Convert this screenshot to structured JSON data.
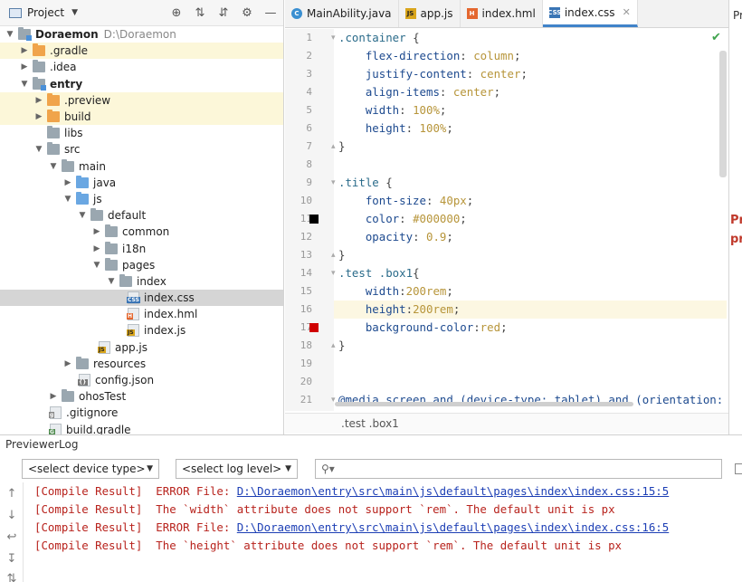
{
  "project_panel": {
    "title": "Project",
    "tree": [
      {
        "label": "Doraemon",
        "path": "D:\\Doraemon",
        "bold": true
      },
      {
        "label": ".gradle"
      },
      {
        "label": ".idea"
      },
      {
        "label": "entry",
        "bold": true
      },
      {
        "label": ".preview"
      },
      {
        "label": "build"
      },
      {
        "label": "libs"
      },
      {
        "label": "src"
      },
      {
        "label": "main"
      },
      {
        "label": "java"
      },
      {
        "label": "js"
      },
      {
        "label": "default"
      },
      {
        "label": "common"
      },
      {
        "label": "i18n"
      },
      {
        "label": "pages"
      },
      {
        "label": "index"
      },
      {
        "label": "index.css"
      },
      {
        "label": "index.hml"
      },
      {
        "label": "index.js"
      },
      {
        "label": "app.js"
      },
      {
        "label": "resources"
      },
      {
        "label": "config.json"
      },
      {
        "label": "ohosTest"
      },
      {
        "label": ".gitignore"
      },
      {
        "label": "build.gradle"
      }
    ]
  },
  "editor": {
    "tabs": [
      {
        "label": "MainAbility.java",
        "icon": "c-class-icon"
      },
      {
        "label": "app.js",
        "icon": "js-file-icon"
      },
      {
        "label": "index.hml",
        "icon": "hml-file-icon"
      },
      {
        "label": "index.css",
        "icon": "css-file-icon",
        "active": true
      }
    ],
    "cut_tab": "Pr",
    "line_numbers": [
      "1",
      "2",
      "3",
      "4",
      "5",
      "6",
      "7",
      "8",
      "9",
      "10",
      "11",
      "12",
      "13",
      "14",
      "15",
      "16",
      "17",
      "18",
      "19",
      "20",
      "21"
    ],
    "code": [
      ".container {",
      "    flex-direction: column;",
      "    justify-content: center;",
      "    align-items: center;",
      "    width: 100%;",
      "    height: 100%;",
      "}",
      "",
      ".title {",
      "    font-size: 40px;",
      "    color: #000000;",
      "    opacity: 0.9;",
      "}",
      ".test .box1{",
      "    width:200rem;",
      "    height:200rem;",
      "    background-color:red;",
      "}",
      "",
      "",
      "@media screen and (device-type: tablet) and (orientation: la"
    ],
    "current_line": "16",
    "swatches": [
      {
        "line": "11",
        "color": "#000000"
      },
      {
        "line": "17",
        "color": "#d00000"
      }
    ],
    "breadcrumb": ".test .box1",
    "right_panel_text": [
      "Pr",
      "pr"
    ]
  },
  "log": {
    "title": "PreviewerLog",
    "device_select": "<select device type>",
    "level_select": "<select log level>",
    "search_placeholder": "",
    "lines": [
      {
        "prefix": "[Compile Result]  ERROR File: ",
        "link": "D:\\Doraemon\\entry\\src\\main\\js\\default\\pages\\index\\index.css:15:5"
      },
      {
        "prefix": "[Compile Result]  The `width` attribute does not support `rem`. The default unit is px",
        "link": ""
      },
      {
        "prefix": "[Compile Result]  ERROR File: ",
        "link": "D:\\Doraemon\\entry\\src\\main\\js\\default\\pages\\index\\index.css:16:5"
      },
      {
        "prefix": "[Compile Result]  The `height` attribute does not support `rem`. The default unit is px",
        "link": ""
      }
    ]
  },
  "colors": {
    "accent": "#4083c9",
    "error": "#b8231d",
    "link": "#1d3fb5",
    "highlight_row": "#fcf7d9",
    "selected_row": "#d5d5d5"
  }
}
